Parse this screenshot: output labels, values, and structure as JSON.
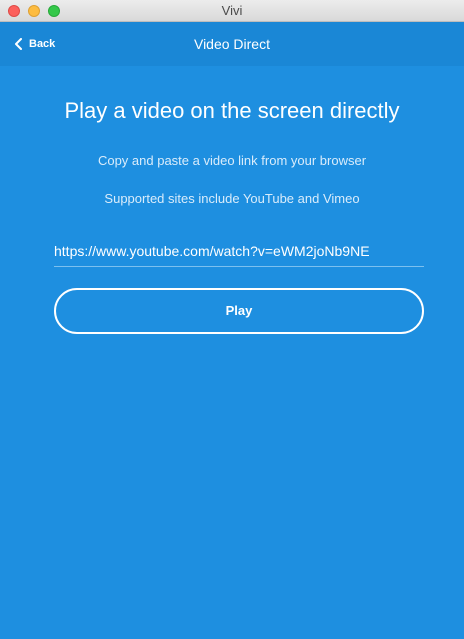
{
  "window": {
    "title": "Vivi"
  },
  "navbar": {
    "back_label": "Back",
    "title": "Video Direct"
  },
  "main": {
    "headline": "Play a video on the screen directly",
    "instruction": "Copy and paste a video link from your browser",
    "supported_sites": "Supported sites include YouTube and Vimeo",
    "url_value": "https://www.youtube.com/watch?v=eWM2joNb9NE",
    "play_label": "Play"
  },
  "colors": {
    "background": "#1e8fe0",
    "navbar": "#1a87d6",
    "text": "#ffffff"
  },
  "icons": {
    "back": "chevron-left-icon"
  }
}
